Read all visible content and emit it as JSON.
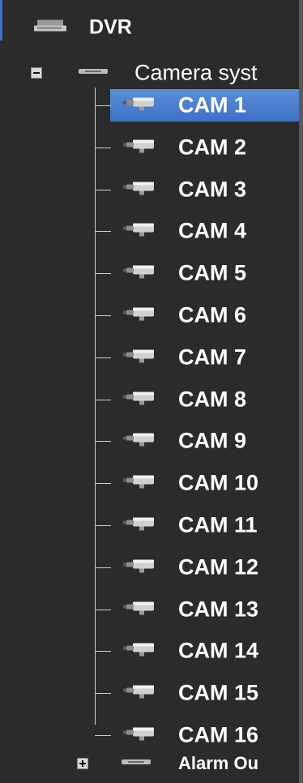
{
  "tree": {
    "root": {
      "label": "DVR",
      "icon": "dvr-icon"
    },
    "camera_group": {
      "label": "Camera syst",
      "icon": "camera-group-icon",
      "expanded": true
    },
    "cameras": [
      {
        "label": "CAM 1",
        "selected": true
      },
      {
        "label": "CAM 2",
        "selected": false
      },
      {
        "label": "CAM 3",
        "selected": false
      },
      {
        "label": "CAM 4",
        "selected": false
      },
      {
        "label": "CAM 5",
        "selected": false
      },
      {
        "label": "CAM 6",
        "selected": false
      },
      {
        "label": "CAM 7",
        "selected": false
      },
      {
        "label": "CAM 8",
        "selected": false
      },
      {
        "label": "CAM 9",
        "selected": false
      },
      {
        "label": "CAM 10",
        "selected": false
      },
      {
        "label": "CAM 11",
        "selected": false
      },
      {
        "label": "CAM 12",
        "selected": false
      },
      {
        "label": "CAM 13",
        "selected": false
      },
      {
        "label": "CAM 14",
        "selected": false
      },
      {
        "label": "CAM 15",
        "selected": false
      },
      {
        "label": "CAM 16",
        "selected": false
      }
    ],
    "alarm_group": {
      "label": "Alarm Ou",
      "icon": "alarm-output-icon",
      "expanded": false
    }
  },
  "colors": {
    "background": "#2b2b2b",
    "selection": "#4a7fcf",
    "text": "#ffffff"
  }
}
